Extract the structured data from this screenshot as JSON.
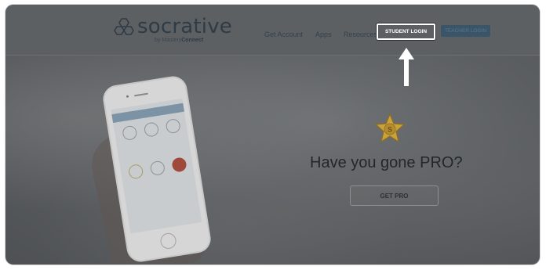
{
  "brand": {
    "name": "socrative",
    "byline_prefix": "by MasteryConnect",
    "byline_brand": "Connect"
  },
  "nav": {
    "links": [
      "Get Account",
      "Apps",
      "Resources"
    ],
    "student_login": "STUDENT LOGIN",
    "teacher_login": "TEACHER LOGIN"
  },
  "hero": {
    "badge_letter": "S",
    "headline": "Have you gone PRO?",
    "cta": "GET PRO"
  },
  "colors": {
    "overlay": "#5d6063",
    "student_border": "#ffffff",
    "teacher_bg": "#3a5468",
    "badge_star": "#c9a23c"
  },
  "icons": [
    "socrative-logo-icon",
    "up-arrow-icon",
    "pro-star-icon"
  ]
}
